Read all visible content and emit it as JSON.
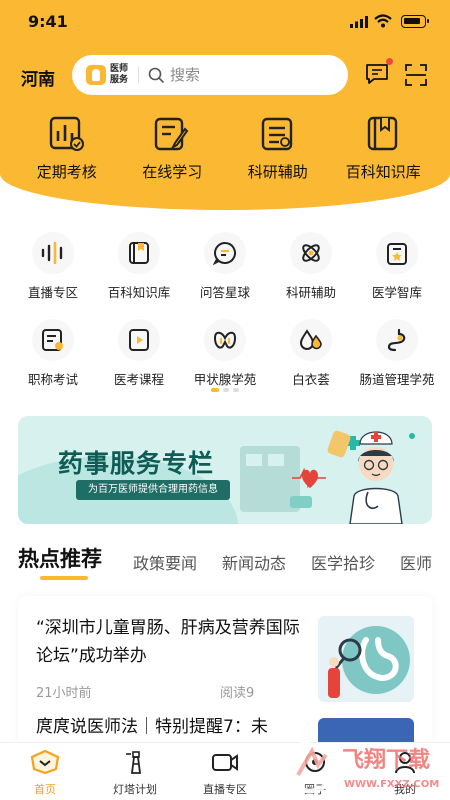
{
  "status": {
    "time": "9:41"
  },
  "header": {
    "region": "河南",
    "brand_line1": "医师",
    "brand_line2": "服务",
    "search_placeholder": "搜索",
    "accent": "#FBB832"
  },
  "top_nav": [
    {
      "label": "定期考核",
      "icon": "chart-check-icon"
    },
    {
      "label": "在线学习",
      "icon": "notepad-pen-icon"
    },
    {
      "label": "科研辅助",
      "icon": "research-stack-icon"
    },
    {
      "label": "百科知识库",
      "icon": "encyclopedia-book-icon"
    }
  ],
  "grid": [
    {
      "label": "直播专区",
      "icon": "soundwave-icon"
    },
    {
      "label": "百科知识库",
      "icon": "book-icon"
    },
    {
      "label": "问答星球",
      "icon": "chat-bubble-icon"
    },
    {
      "label": "科研辅助",
      "icon": "atom-icon"
    },
    {
      "label": "医学智库",
      "icon": "clipboard-star-icon"
    },
    {
      "label": "职称考试",
      "icon": "exam-paper-icon"
    },
    {
      "label": "医考课程",
      "icon": "video-course-icon"
    },
    {
      "label": "甲状腺学苑",
      "icon": "thyroid-icon"
    },
    {
      "label": "白衣荟",
      "icon": "drops-icon"
    },
    {
      "label": "肠道管理学苑",
      "icon": "intestine-icon"
    }
  ],
  "banner": {
    "title": "药事服务专栏",
    "subtitle": "为百万医师提供合理用药信息"
  },
  "tabs": [
    "热点推荐",
    "政策要闻",
    "新闻动态",
    "医学拾珍",
    "医师"
  ],
  "active_tab": 0,
  "articles": [
    {
      "title": "“深圳市儿童胃肠、肝病及营养国际论坛”成功举办",
      "time": "21小时前",
      "reads": "阅读9"
    },
    {
      "title": "庹庹说医师法｜特别提醒7：未"
    }
  ],
  "bottom_nav": [
    {
      "label": "首页",
      "icon": "home-icon",
      "active": true
    },
    {
      "label": "灯塔计划",
      "icon": "lighthouse-icon"
    },
    {
      "label": "直播专区",
      "icon": "camera-icon"
    },
    {
      "label": "圈子",
      "icon": "circle-icon"
    },
    {
      "label": "我的",
      "icon": "user-icon"
    }
  ],
  "watermark": {
    "text": "飞翔下载",
    "url_text": "WWW.FXXZ.COM"
  }
}
